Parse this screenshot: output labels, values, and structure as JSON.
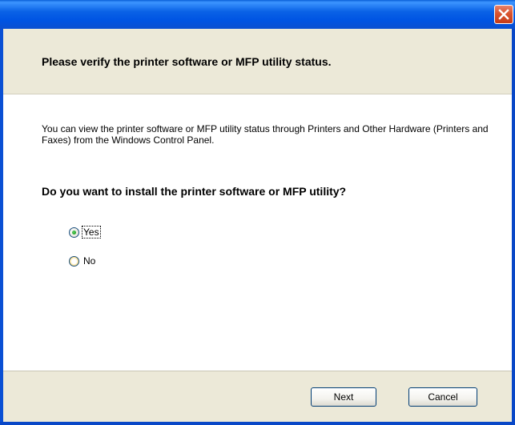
{
  "titlebar": {
    "close_icon": "close-icon",
    "close_color": "#d9532e"
  },
  "header": {
    "title": "Please verify the printer software or MFP utility status."
  },
  "content": {
    "info_text": "You can view the printer software or MFP utility status through Printers and Other Hardware (Printers and Faxes) from the Windows Control Panel.",
    "question": "Do you want to install the printer software or MFP utility?",
    "options": [
      {
        "label": "Yes",
        "selected": true
      },
      {
        "label": "No",
        "selected": false
      }
    ]
  },
  "footer": {
    "next_label": "Next",
    "cancel_label": "Cancel"
  },
  "colors": {
    "titlebar_blue": "#0054e3",
    "panel_beige": "#ece9d8",
    "radio_selected_green": "#21a121"
  }
}
